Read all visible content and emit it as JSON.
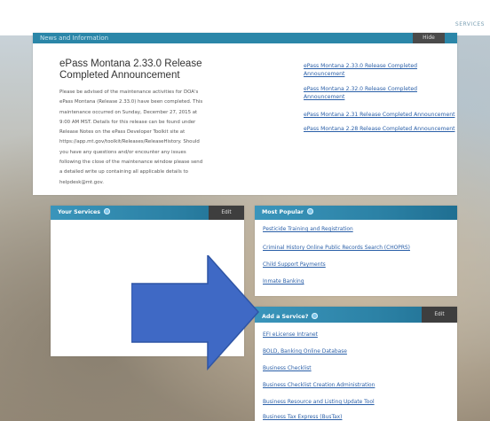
{
  "header": {
    "services_label": "SERVICES"
  },
  "news": {
    "header_title": "News and Information",
    "header_button": "Hide",
    "title": "ePass Montana 2.33.0 Release Completed Announcement",
    "body_lines": [
      "Please be advised of the maintenance activities for DOA's",
      "ePass Montana (Release 2.33.0) have been completed. This",
      "maintenance occurred on Sunday, December 27, 2015 at",
      "9:00 AM MST. Details for this release can be found under",
      "Release Notes on the ePass Developer Toolkit site at",
      "https://app.mt.gov/toolkit/Releases/ReleaseHistory. Should",
      "you have any questions and/or encounter any issues",
      "following the close of the maintenance window please send",
      "a detailed write up containing all applicable details to",
      "helpdesk@mt.gov."
    ],
    "links": [
      "ePass Montana 2.33.0 Release Completed Announcement",
      "ePass Montana 2.32.0 Release Completed Announcement",
      "ePass Montana 2.31 Release Completed Announcement",
      "ePass Montana 2.28 Release Completed Announcement"
    ]
  },
  "your_services": {
    "title": "Your Services",
    "edit_label": "Edit"
  },
  "most_popular": {
    "title": "Most Popular",
    "links": [
      "Pesticide Training and Registration",
      "Criminal History Online Public Records Search (CHOPRS)",
      "Child Support Payments",
      "Inmate Banking"
    ]
  },
  "add_service": {
    "title": "Add a Service?",
    "edit_label": "Edit",
    "links": [
      "EFI eLicense Intranet",
      "BOLD, Banking Online Database",
      "Business Checklist",
      "Business Checklist Creation Administration",
      "Business Resource and Listing Update Tool",
      "Business Tax Express (BusTax)"
    ]
  },
  "colors": {
    "panel_header": "#2c82a6",
    "link": "#2a5fa8",
    "arrow": "#3f69c5"
  }
}
